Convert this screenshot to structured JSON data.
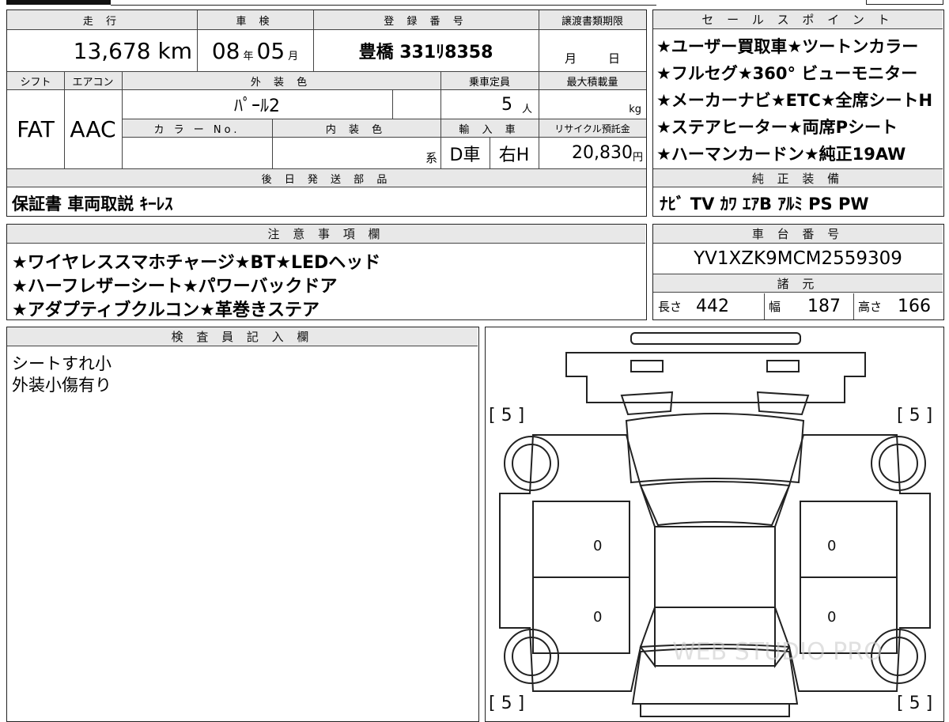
{
  "top_block": {
    "headers": {
      "mileage": "走 行",
      "inspection": "車 検",
      "registration": "登 録 番 号",
      "transfer_deadline": "譲渡書類期限",
      "shift": "シフト",
      "aircon": "エアコン",
      "exterior_color": "外 装 色",
      "capacity": "乗車定員",
      "max_load": "最大積載量",
      "color_no": "カ ラ ー No.",
      "interior_color": "内 装 色",
      "import": "輸 入 車",
      "recycle": "リサイクル預託金",
      "later_parts": "後 日 発 送 部 品"
    },
    "mileage_value": "13,678 km",
    "inspection_year": "08",
    "inspection_year_unit": "年",
    "inspection_month": "05",
    "inspection_month_unit": "月",
    "registration_value": "豊橋 331ﾘ8358",
    "transfer_month_unit": "月",
    "transfer_day_unit": "日",
    "shift_value": "FAT",
    "aircon_value": "AAC",
    "exterior_color_value": "ﾊﾟｰﾙ2",
    "capacity_value": "5",
    "capacity_unit": "人",
    "max_load_unit": "kg",
    "interior_unit": "系",
    "import_type": "D車",
    "handle": "右H",
    "recycle_value": "20,830",
    "recycle_unit": "円",
    "later_parts_value": "保証書 車両取説 ｷｰﾚｽ"
  },
  "sales_points": {
    "header": "セ ー ル ス ポ イ ン ト",
    "lines": [
      "★ユーザー買取車★ツートンカラー",
      "★フルセグ★360° ビューモニター",
      "★メーカーナビ★ETC★全席シートH",
      "★ステアヒーター★両席Pシート",
      "★ハーマンカードン★純正19AW"
    ]
  },
  "genuine_equipment": {
    "header": "純 正 装 備",
    "value": "ﾅﾋﾞ TV ｶﾜ ｴｱB ｱﾙﾐ PS PW"
  },
  "notes": {
    "header": "注 意 事 項 欄",
    "lines": [
      "★ワイヤレススマホチャージ★BT★LEDヘッド",
      "★ハーフレザーシート★パワーバックドア",
      "★アダプティブクルコン★革巻きステア"
    ]
  },
  "chassis": {
    "header": "車 台 番 号",
    "value": "YV1XZK9MCM2559309"
  },
  "specs": {
    "header": "諸 元",
    "length_label": "長さ",
    "length_value": "442",
    "width_label": "幅",
    "width_value": "187",
    "height_label": "高さ",
    "height_value": "166"
  },
  "inspector": {
    "header": "検 査 員 記 入 欄",
    "lines": [
      "シートすれ小",
      "外装小傷有り"
    ]
  },
  "diagram": {
    "tire_labels": [
      "[ 5 ]",
      "[ 5 ]",
      "[ 5 ]",
      "[ 5 ]"
    ],
    "door_marks": [
      "0",
      "0",
      "0",
      "0"
    ],
    "watermark": "WEB STUDIO PRO"
  }
}
